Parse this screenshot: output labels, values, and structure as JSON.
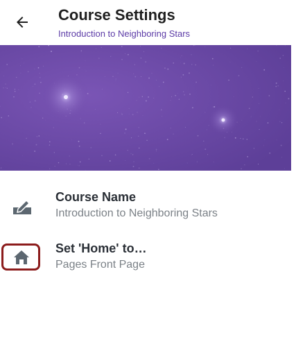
{
  "header": {
    "title": "Course Settings",
    "subtitle": "Introduction to Neighboring Stars",
    "back_icon": "arrow-left-icon"
  },
  "banner": {
    "description_color": "#6a47a5"
  },
  "settings": [
    {
      "icon": "edit-icon",
      "title": "Course Name",
      "value": "Introduction to Neighboring Stars"
    },
    {
      "icon": "home-icon",
      "title": "Set 'Home' to…",
      "value": "Pages Front Page"
    }
  ],
  "colors": {
    "accent": "#5b3aa6",
    "banner": "#6a47a5",
    "icon": "#5c6770",
    "highlight": "#8c1c1c"
  }
}
